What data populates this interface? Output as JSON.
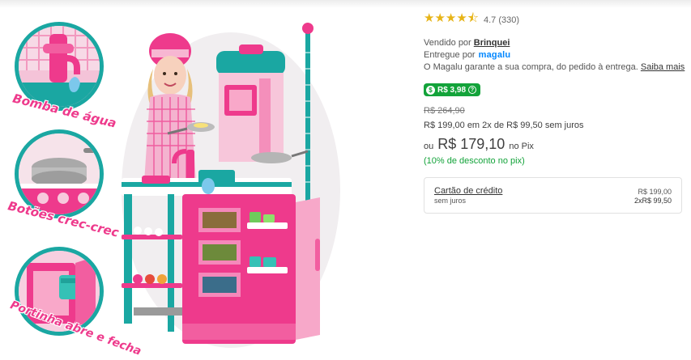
{
  "product_image": {
    "features": [
      {
        "label": "Bomba de água",
        "icon": "water-pump-icon"
      },
      {
        "label": "Botões crec-crec",
        "icon": "stove-buttons-icon"
      },
      {
        "label": "Portinha abre e fecha",
        "icon": "oven-door-icon"
      }
    ],
    "colors": {
      "pink": "#ee3a8c",
      "teal": "#1aa7a2",
      "light_pink": "#f7d3e3"
    }
  },
  "rating": {
    "stars": "★★★★⯪",
    "value": 4.7,
    "text": "4.7 (330)"
  },
  "seller": {
    "prefix": "Vendido por",
    "name": "Brinquei"
  },
  "delivery": {
    "prefix": "Entregue por",
    "brand": "magalu"
  },
  "guarantee": {
    "text": "O Magalu garante a sua compra, do pedido à entrega.",
    "link": "Saiba mais"
  },
  "cashback": {
    "label": "R$ 3,98",
    "icon": "cashback-icon",
    "info_icon": "info-icon"
  },
  "pricing": {
    "old_price": "R$ 264,90",
    "installments": "R$ 199,00 em 2x de R$ 99,50 sem juros",
    "pix_prefix": "ou",
    "pix_price": "R$ 179,10",
    "pix_suffix": "no Pix",
    "discount": "(10% de desconto no pix)"
  },
  "payment_option": {
    "title": "Cartão de crédito",
    "subtitle": "sem juros",
    "total": "R$ 199,00",
    "installments": "2xR$ 99,50"
  },
  "accent_colors": {
    "stars": "#e7b417",
    "green": "#13a33a",
    "magalu_blue": "#0086ff"
  }
}
